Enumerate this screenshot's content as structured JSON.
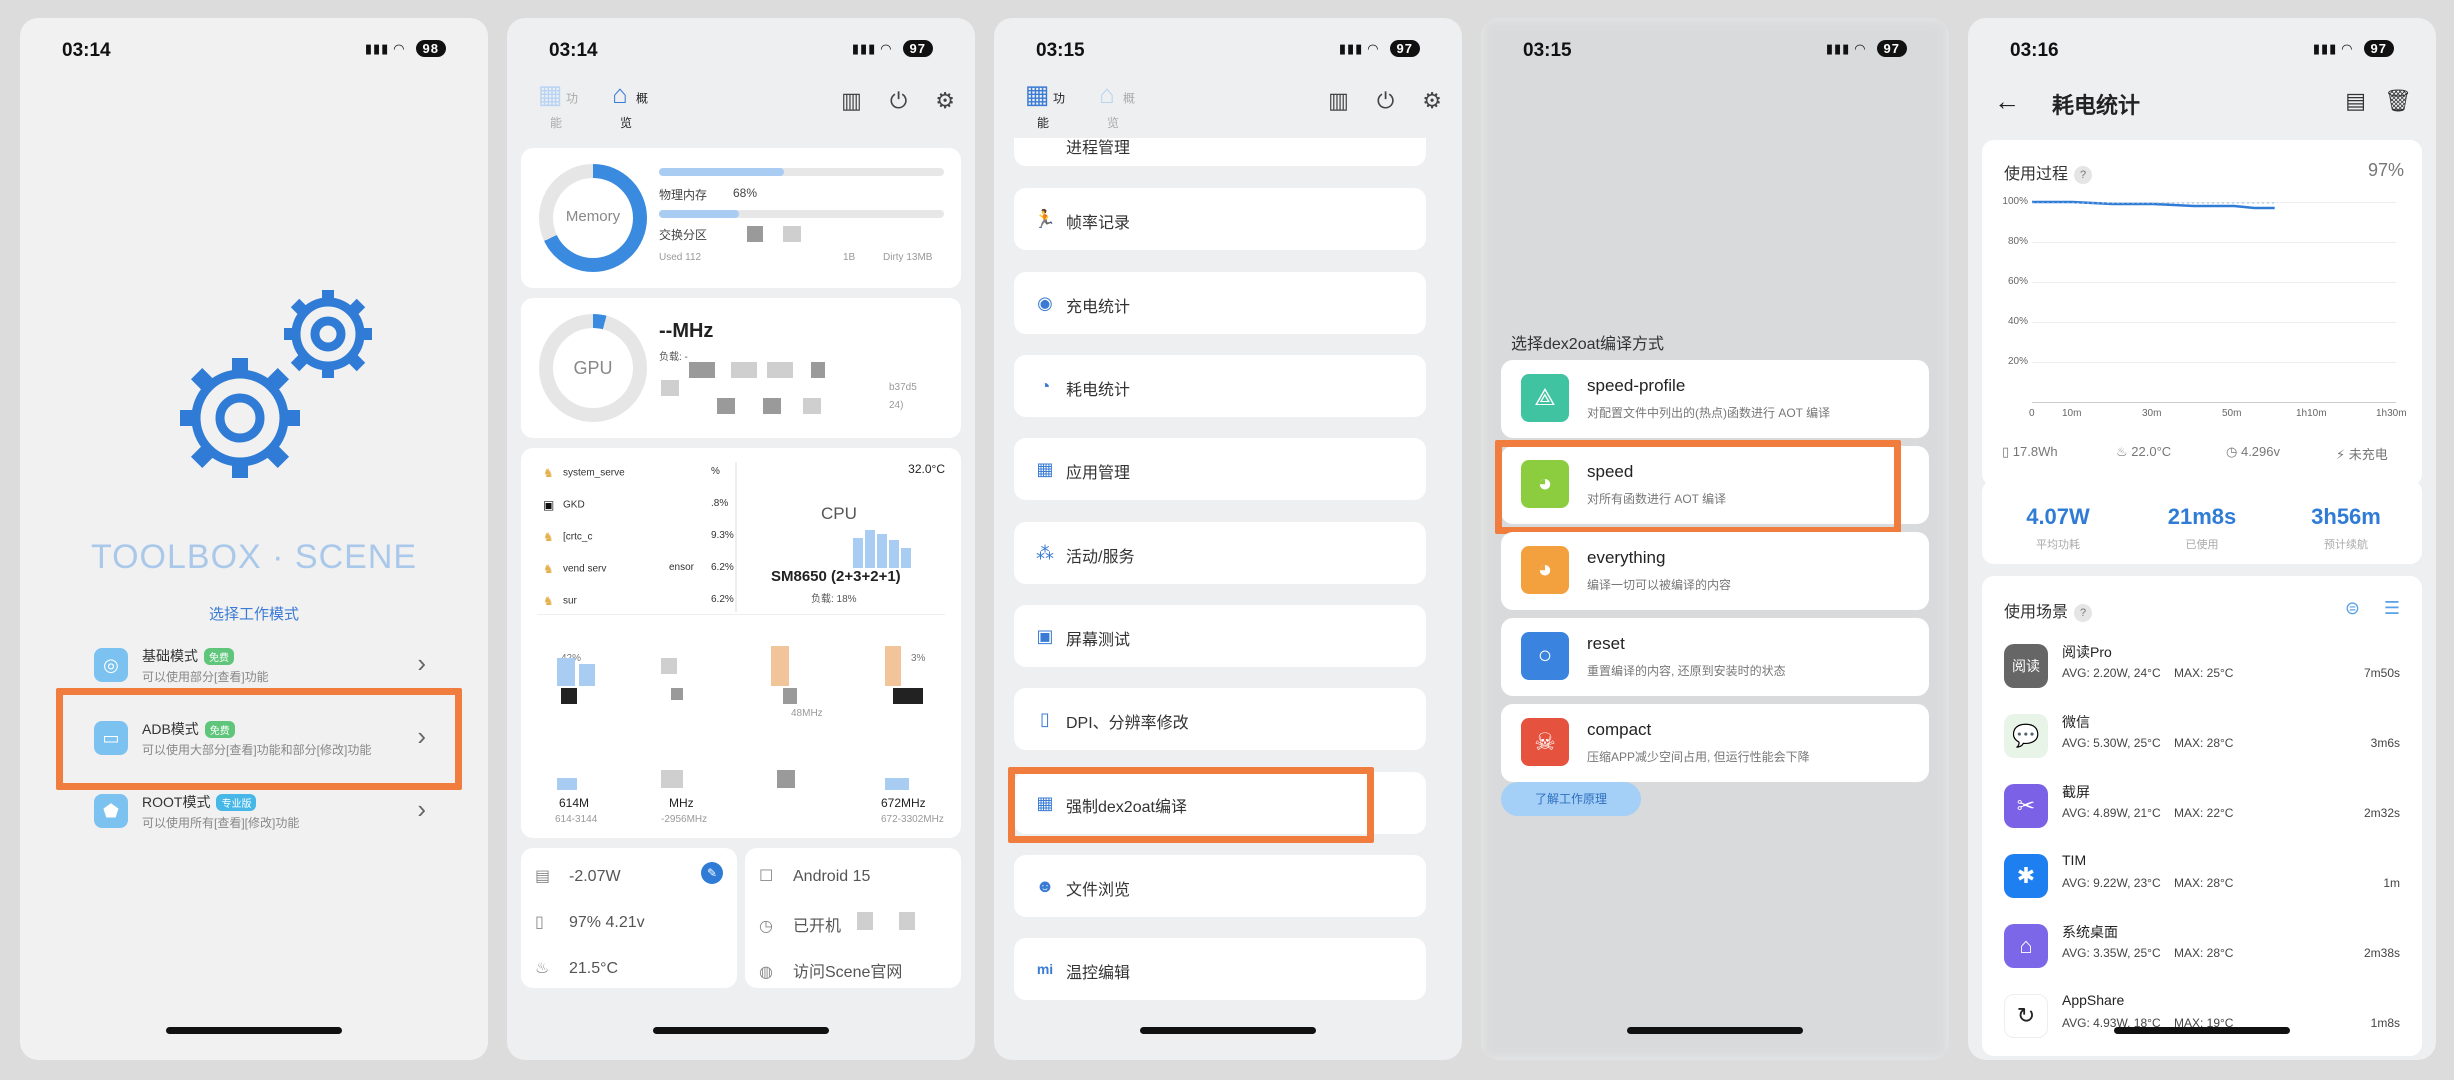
{
  "phones": [
    {
      "time": "03:14",
      "battery": "98"
    },
    {
      "time": "03:14",
      "battery": "97"
    },
    {
      "time": "03:15",
      "battery": "97"
    },
    {
      "time": "03:15",
      "battery": "97"
    },
    {
      "time": "03:16",
      "battery": "97"
    }
  ],
  "p1": {
    "brand": "TOOLBOX · SCENE",
    "select_mode": "选择工作模式",
    "modes": [
      {
        "title": "基础模式",
        "tag": "免费",
        "desc": "可以使用部分[查看]功能"
      },
      {
        "title": "ADB模式",
        "tag": "免费",
        "desc": "可以使用大部分[查看]功能和部分[修改]功能"
      },
      {
        "title": "ROOT模式",
        "tag": "专业版",
        "desc": "可以使用所有[查看][修改]功能"
      }
    ]
  },
  "p2": {
    "tabs": [
      {
        "label": "功能"
      },
      {
        "label": "概览"
      }
    ],
    "memory": {
      "ring_label": "Memory",
      "percent": 68,
      "physical_label": "物理内存",
      "physical_value": "68%",
      "swap_label": "交换分区",
      "used": "Used 112",
      "one_b": "1B",
      "dirty": "Dirty 13MB"
    },
    "gpu": {
      "ring_label": "GPU",
      "freq": "--MHz",
      "load": "负载: -",
      "tail1": "b37d5",
      "tail2": "24)"
    },
    "cpu": {
      "temp": "32.0°C",
      "label": "CPU",
      "model": "SM8650 (2+3+2+1)",
      "load": "负载: 18%"
    },
    "processes": [
      {
        "name": "system_serve",
        "pct": "%"
      },
      {
        "name": "GKD",
        "pct": ".8%"
      },
      {
        "name": "[crtc_c",
        "pct": "9.3%"
      },
      {
        "name": "vend serv",
        "extra": "ensor",
        "pct": "6.2%"
      },
      {
        "name": "sur",
        "pct": "6.2%"
      }
    ],
    "cores": [
      {
        "pct": "42%",
        "freq": "614M",
        "range": "614-3144"
      },
      {
        "pct": "",
        "freq": "MHz",
        "range": "-2956MHz"
      },
      {
        "pct": "",
        "freq": "",
        "range": "48MHz"
      },
      {
        "pct": "3%",
        "freq": "672MHz",
        "range": "672-3302MHz"
      }
    ],
    "power": "-2.07W",
    "battery": "97%  4.21v",
    "temp": "21.5°C",
    "android": "Android 15",
    "uptime": "已开机",
    "visit": "访问Scene官网"
  },
  "p3": {
    "tabs": [
      {
        "label": "功能"
      },
      {
        "label": "概览"
      }
    ],
    "partial": "进程管理",
    "items": [
      {
        "label": "帧率记录",
        "icon": "run-icon"
      },
      {
        "label": "充电统计",
        "icon": "charge-icon"
      },
      {
        "label": "耗电统计",
        "icon": "pie-icon"
      },
      {
        "label": "应用管理",
        "icon": "grid-icon"
      },
      {
        "label": "活动/服务",
        "icon": "cluster-icon"
      },
      {
        "label": "屏幕测试",
        "icon": "screen-icon"
      },
      {
        "label": "DPI、分辨率修改",
        "icon": "phone-icon"
      },
      {
        "label": "强制dex2oat编译",
        "icon": "grid-icon"
      },
      {
        "label": "文件浏览",
        "icon": "mask-icon"
      },
      {
        "label": "温控编辑",
        "icon": "mi-icon"
      }
    ]
  },
  "p4": {
    "sheet_title": "选择dex2oat编译方式",
    "options": [
      {
        "title": "speed-profile",
        "desc": "对配置文件中列出的(热点)函数进行 AOT 编译",
        "color": "#3fc3a0"
      },
      {
        "title": "speed",
        "desc": "对所有函数进行 AOT 编译",
        "color": "#8ccd3f"
      },
      {
        "title": "everything",
        "desc": "编译一切可以被编译的内容",
        "color": "#f2a13e"
      },
      {
        "title": "reset",
        "desc": "重置编译的内容, 还原到安装时的状态",
        "color": "#3a84e0"
      },
      {
        "title": "compact",
        "desc": "压缩APP减少空间占用, 但运行性能会下降",
        "color": "#e5533f"
      }
    ],
    "learn": "了解工作原理"
  },
  "p5": {
    "title": "耗电统计",
    "usage_title": "使用过程",
    "usage_pct": "97%",
    "chart_data": {
      "type": "line",
      "title": "使用过程",
      "xlabel": "",
      "ylabel": "",
      "x_ticks": [
        "0",
        "10m",
        "30m",
        "50m",
        "1h10m",
        "1h30m"
      ],
      "y_ticks": [
        "100%",
        "80%",
        "60%",
        "40%",
        "20%"
      ],
      "ylim": [
        0,
        100
      ],
      "series": [
        {
          "x": [
            0,
            10,
            20,
            30,
            40,
            50,
            55,
            60
          ],
          "values": [
            100,
            100,
            99,
            99,
            98,
            98,
            97,
            97
          ]
        }
      ]
    },
    "stats": {
      "energy": "17.8Wh",
      "temp": "22.0°C",
      "voltage": "4.296v",
      "charge": "未充电"
    },
    "summary": [
      {
        "value": "4.07W",
        "label": "平均功耗"
      },
      {
        "value": "21m8s",
        "label": "已使用"
      },
      {
        "value": "3h56m",
        "label": "预计续航"
      }
    ],
    "scenes_title": "使用场景",
    "apps": [
      {
        "name": "阅读Pro",
        "avg": "AVG: 2.20W, 24°C",
        "max": "MAX:  25°C",
        "time": "7m50s",
        "color": "#666666",
        "glyph": "阅读"
      },
      {
        "name": "微信",
        "avg": "AVG: 5.30W, 25°C",
        "max": "MAX:  28°C",
        "time": "3m6s",
        "color": "#e9f4e9",
        "glyph": "💬"
      },
      {
        "name": "截屏",
        "avg": "AVG: 4.89W, 21°C",
        "max": "MAX:  22°C",
        "time": "2m32s",
        "color": "#7b61e6",
        "glyph": "✂"
      },
      {
        "name": "TIM",
        "avg": "AVG: 9.22W, 23°C",
        "max": "MAX:  28°C",
        "time": "1m",
        "color": "#1e7ff0",
        "glyph": "✱"
      },
      {
        "name": "系统桌面",
        "avg": "AVG: 3.35W, 25°C",
        "max": "MAX:  28°C",
        "time": "2m38s",
        "color": "#7b67e8",
        "glyph": "⌂"
      },
      {
        "name": "AppShare",
        "avg": "AVG: 4.93W, 18°C",
        "max": "MAX:  19°C",
        "time": "1m8s",
        "color": "#ffffff",
        "glyph": "↻"
      }
    ]
  }
}
